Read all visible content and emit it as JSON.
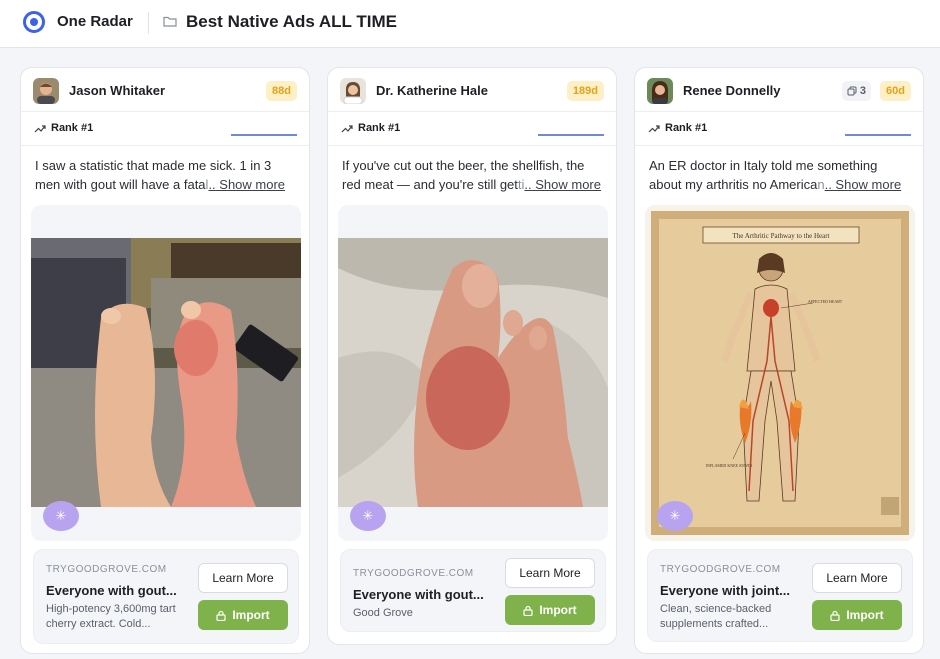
{
  "app": {
    "name": "One Radar",
    "board_title": "Best Native Ads ALL TIME"
  },
  "colors": {
    "accent": "#3b63e6",
    "import": "#7fb24a",
    "days_badge_bg": "#fdf0c6",
    "days_badge_text": "#e3a21a",
    "spinner": "#b8a3f0"
  },
  "cards": [
    {
      "author": "Jason Whitaker",
      "days": "88d",
      "rank": "Rank  #1",
      "text_lead": "I saw a statistic that made me sick. 1 in 3 men with gout will have a fata",
      "text_fade": "l",
      "show_more": ".. Show more",
      "image_icon": "swollen-gout-feet-photo",
      "domain": "TRYGOODGROVE.COM",
      "headline": "Everyone with gout...",
      "description": "High-potency 3,600mg tart cherry extract. Cold...",
      "learn_more": "Learn More",
      "import": "Import"
    },
    {
      "author": "Dr. Katherine Hale",
      "days": "189d",
      "rank": "Rank  #1",
      "text_lead": "If you've cut out the beer, the shellfish, the red meat — and you're still get",
      "text_fade": "ti",
      "show_more": ".. Show more",
      "image_icon": "swollen-toe-photo",
      "domain": "TRYGOODGROVE.COM",
      "headline": "Everyone with gout...",
      "description": "Good Grove",
      "learn_more": "Learn More",
      "import": "Import"
    },
    {
      "author": "Renee Donnelly",
      "days": "60d",
      "duplicates": "3",
      "rank": "Rank  #1",
      "text_lead": "An ER doctor in Italy told me something about my arthritis no America",
      "text_fade": "n",
      "show_more": ".. Show more",
      "image_icon": "arthritic-pathway-illustration",
      "image_title": "The Arthritic Pathway to the Heart",
      "image_label_heart": "AFFECTED HEART",
      "image_label_knee": "INFLAMED KNEE JOINTS",
      "domain": "TRYGOODGROVE.COM",
      "headline": "Everyone with joint...",
      "description": "Clean, science-backed supplements crafted...",
      "learn_more": "Learn More",
      "import": "Import"
    }
  ]
}
